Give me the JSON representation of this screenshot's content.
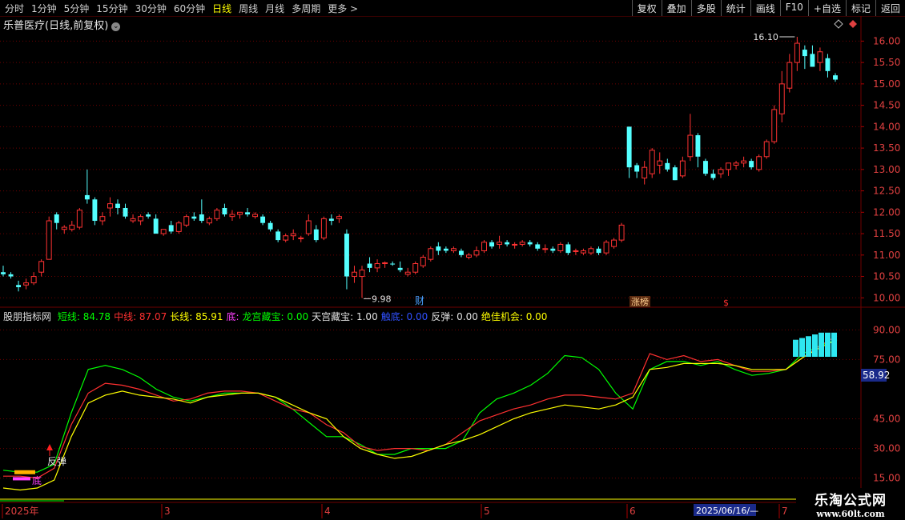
{
  "toolbar": {
    "periods": [
      "分时",
      "1分钟",
      "5分钟",
      "15分钟",
      "30分钟",
      "60分钟",
      "日线",
      "周线",
      "月线",
      "多周期",
      "更多 >"
    ],
    "active_period": "日线",
    "right_buttons": [
      "复权",
      "叠加",
      "多股",
      "统计",
      "画线",
      "F10",
      "+自选",
      "标记",
      "返回"
    ]
  },
  "stock_title": "乐普医疗(日线,前复权)",
  "indicator": {
    "name": "股朋指标网",
    "items": [
      {
        "label": "短线",
        "value": "84.78",
        "color": "#00ff00"
      },
      {
        "label": "中线",
        "value": "87.07",
        "color": "#ff3030"
      },
      {
        "label": "长线",
        "value": "85.91",
        "color": "#ffff00"
      },
      {
        "label": "底",
        "value": "",
        "color": "#ff40ff"
      },
      {
        "label": "龙宫藏宝",
        "value": "0.00",
        "color": "#00ff00"
      },
      {
        "label": "天宫藏宝",
        "value": "1.00",
        "color": "#e0e0e0"
      },
      {
        "label": "触底",
        "value": "0.00",
        "color": "#3050ff"
      },
      {
        "label": "反弹",
        "value": "0.00",
        "color": "#e0e0e0"
      },
      {
        "label": "绝佳机会",
        "value": "0.00",
        "color": "#ffff00"
      }
    ]
  },
  "annotations": {
    "high_label": "16.10",
    "low_label": "9.98",
    "rebound_label": "反弹",
    "bottom_label": "底",
    "badge_cai": "财",
    "badge_zhangbang": "涨榜",
    "badge_s": "$",
    "current_value": "58.92"
  },
  "time_axis": {
    "labels": [
      "2025年",
      "3",
      "4",
      "5",
      "6",
      "7"
    ],
    "cursor_date": "2025/06/16/—"
  },
  "watermark": {
    "line1": "乐淘公式网",
    "line2": "www.60lt.com"
  },
  "colors": {
    "up": "#ff3232",
    "down": "#54ffff",
    "grid": "#6e0000"
  },
  "chart_data": [
    {
      "type": "candlestick",
      "title": "乐普医疗(日线,前复权)",
      "ylim": [
        9.8,
        16.25
      ],
      "yticks": [
        10.0,
        10.5,
        11.0,
        11.5,
        12.0,
        12.5,
        13.0,
        13.5,
        14.0,
        14.5,
        15.0,
        15.5,
        16.0
      ],
      "high": 16.1,
      "low": 9.98,
      "ohlc": [
        [
          10.6,
          10.75,
          10.5,
          10.55
        ],
        [
          10.55,
          10.6,
          10.45,
          10.5
        ],
        [
          10.3,
          10.4,
          10.15,
          10.25
        ],
        [
          10.3,
          10.45,
          10.2,
          10.35
        ],
        [
          10.35,
          10.6,
          10.3,
          10.5
        ],
        [
          10.6,
          10.9,
          10.5,
          10.85
        ],
        [
          10.9,
          11.9,
          10.9,
          11.8
        ],
        [
          11.95,
          12.0,
          11.6,
          11.75
        ],
        [
          11.6,
          11.7,
          11.5,
          11.65
        ],
        [
          11.6,
          11.8,
          11.55,
          11.7
        ],
        [
          11.65,
          12.1,
          11.6,
          12.05
        ],
        [
          12.4,
          13.0,
          12.2,
          12.3
        ],
        [
          12.3,
          12.35,
          11.7,
          11.8
        ],
        [
          11.8,
          12.0,
          11.7,
          11.9
        ],
        [
          12.1,
          12.35,
          11.9,
          12.2
        ],
        [
          12.2,
          12.3,
          11.95,
          12.1
        ],
        [
          12.1,
          12.2,
          11.85,
          11.9
        ],
        [
          11.8,
          11.95,
          11.75,
          11.85
        ],
        [
          11.8,
          11.95,
          11.7,
          11.9
        ],
        [
          11.95,
          12.0,
          11.85,
          11.9
        ],
        [
          11.85,
          11.95,
          11.5,
          11.5
        ],
        [
          11.5,
          11.6,
          11.45,
          11.6
        ],
        [
          11.7,
          11.8,
          11.5,
          11.55
        ],
        [
          11.55,
          11.8,
          11.5,
          11.75
        ],
        [
          11.7,
          11.95,
          11.65,
          11.9
        ],
        [
          11.9,
          12.0,
          11.8,
          11.85
        ],
        [
          11.95,
          12.3,
          11.75,
          11.8
        ],
        [
          11.75,
          11.9,
          11.7,
          11.85
        ],
        [
          11.85,
          12.1,
          11.8,
          12.05
        ],
        [
          12.1,
          12.2,
          11.9,
          11.95
        ],
        [
          11.9,
          12.05,
          11.8,
          11.95
        ],
        [
          11.95,
          12.0,
          11.85,
          12.0
        ],
        [
          12.0,
          12.1,
          11.9,
          11.95
        ],
        [
          11.9,
          12.0,
          11.85,
          11.95
        ],
        [
          11.9,
          11.95,
          11.7,
          11.75
        ],
        [
          11.75,
          11.8,
          11.55,
          11.6
        ],
        [
          11.55,
          11.6,
          11.3,
          11.35
        ],
        [
          11.35,
          11.5,
          11.3,
          11.45
        ],
        [
          11.45,
          11.6,
          11.35,
          11.5
        ],
        [
          11.4,
          11.45,
          11.3,
          11.4
        ],
        [
          11.5,
          11.95,
          11.45,
          11.8
        ],
        [
          11.6,
          11.7,
          11.3,
          11.35
        ],
        [
          11.4,
          11.9,
          11.35,
          11.85
        ],
        [
          11.85,
          11.95,
          11.7,
          11.8
        ],
        [
          11.85,
          11.95,
          11.75,
          11.9
        ],
        [
          11.5,
          11.6,
          10.2,
          10.5
        ],
        [
          10.5,
          10.75,
          10.35,
          10.6
        ],
        [
          10.5,
          10.75,
          10.0,
          10.65
        ],
        [
          10.8,
          10.95,
          10.6,
          10.7
        ],
        [
          10.7,
          10.9,
          10.6,
          10.8
        ],
        [
          10.8,
          10.85,
          10.7,
          10.82
        ],
        [
          10.8,
          10.85,
          10.75,
          10.78
        ],
        [
          10.7,
          10.85,
          10.6,
          10.65
        ],
        [
          10.55,
          10.7,
          10.5,
          10.6
        ],
        [
          10.6,
          10.85,
          10.55,
          10.8
        ],
        [
          10.75,
          11.0,
          10.7,
          10.95
        ],
        [
          10.9,
          11.2,
          10.85,
          11.15
        ],
        [
          11.2,
          11.3,
          11.0,
          11.1
        ],
        [
          11.15,
          11.2,
          11.05,
          11.1
        ],
        [
          11.1,
          11.2,
          11.05,
          11.15
        ],
        [
          11.1,
          11.15,
          10.95,
          11.0
        ],
        [
          10.95,
          11.05,
          10.9,
          11.0
        ],
        [
          11.0,
          11.2,
          10.95,
          11.1
        ],
        [
          11.1,
          11.35,
          11.05,
          11.3
        ],
        [
          11.3,
          11.35,
          11.15,
          11.2
        ],
        [
          11.25,
          11.45,
          11.15,
          11.3
        ],
        [
          11.3,
          11.35,
          11.2,
          11.25
        ],
        [
          11.25,
          11.3,
          11.15,
          11.25
        ],
        [
          11.25,
          11.35,
          11.2,
          11.3
        ],
        [
          11.3,
          11.35,
          11.2,
          11.25
        ],
        [
          11.25,
          11.3,
          11.1,
          11.15
        ],
        [
          11.15,
          11.25,
          11.05,
          11.15
        ],
        [
          11.15,
          11.2,
          11.05,
          11.1
        ],
        [
          11.1,
          11.3,
          11.05,
          11.25
        ],
        [
          11.25,
          11.3,
          11.0,
          11.05
        ],
        [
          11.1,
          11.15,
          11.0,
          11.1
        ],
        [
          11.05,
          11.15,
          11.0,
          11.1
        ],
        [
          11.05,
          11.2,
          11.0,
          11.15
        ],
        [
          11.15,
          11.2,
          11.0,
          11.05
        ],
        [
          11.05,
          11.35,
          11.0,
          11.3
        ],
        [
          11.2,
          11.4,
          11.15,
          11.35
        ],
        [
          11.35,
          11.75,
          11.3,
          11.7
        ],
        [
          14.0,
          14.0,
          12.8,
          13.05
        ],
        [
          13.1,
          13.15,
          12.8,
          12.95
        ],
        [
          12.8,
          13.2,
          12.65,
          13.05
        ],
        [
          12.9,
          13.5,
          12.8,
          13.45
        ],
        [
          13.1,
          13.4,
          12.9,
          13.2
        ],
        [
          13.15,
          13.25,
          12.95,
          13.0
        ],
        [
          13.05,
          13.1,
          12.75,
          12.75
        ],
        [
          12.85,
          13.3,
          12.8,
          13.2
        ],
        [
          13.3,
          14.3,
          13.2,
          13.8
        ],
        [
          13.8,
          13.85,
          13.05,
          13.3
        ],
        [
          13.2,
          13.25,
          12.85,
          12.9
        ],
        [
          12.9,
          13.0,
          12.75,
          12.8
        ],
        [
          12.9,
          13.05,
          12.8,
          13.0
        ],
        [
          13.0,
          13.15,
          12.85,
          13.15
        ],
        [
          13.1,
          13.2,
          13.0,
          13.15
        ],
        [
          13.15,
          13.3,
          13.05,
          13.2
        ],
        [
          13.2,
          13.25,
          13.0,
          13.05
        ],
        [
          13.0,
          13.35,
          12.95,
          13.3
        ],
        [
          13.3,
          13.7,
          13.25,
          13.65
        ],
        [
          13.65,
          14.5,
          13.6,
          14.4
        ],
        [
          14.3,
          15.3,
          14.1,
          15.0
        ],
        [
          14.9,
          15.7,
          14.8,
          15.5
        ],
        [
          15.5,
          16.1,
          15.3,
          15.95
        ],
        [
          15.8,
          15.9,
          15.35,
          15.65
        ],
        [
          15.7,
          15.9,
          15.4,
          15.4
        ],
        [
          15.5,
          15.85,
          15.3,
          15.75
        ],
        [
          15.6,
          15.7,
          15.15,
          15.3
        ],
        [
          15.2,
          15.25,
          15.05,
          15.1
        ]
      ]
    },
    {
      "type": "line",
      "title": "股朋指标网",
      "ylim": [
        10,
        95
      ],
      "yticks": [
        15.0,
        30.0,
        45.0,
        75.0,
        90.0
      ],
      "series": [
        {
          "name": "短线",
          "color": "#00ff00",
          "values": [
            19,
            18,
            18,
            22,
            48,
            70,
            72,
            70,
            66,
            60,
            56,
            54,
            56,
            58,
            58,
            58,
            56,
            50,
            43,
            36,
            36,
            32,
            27,
            27,
            30,
            30,
            30,
            34,
            48,
            55,
            58,
            62,
            68,
            77,
            76,
            70,
            58,
            50,
            70,
            74,
            74,
            72,
            74,
            70,
            67,
            68,
            70,
            78,
            82,
            85
          ]
        },
        {
          "name": "中线",
          "color": "#ff3030",
          "values": [
            16,
            16,
            15,
            20,
            42,
            58,
            63,
            62,
            60,
            57,
            54,
            55,
            58,
            59,
            59,
            58,
            54,
            50,
            48,
            42,
            38,
            31,
            29,
            30,
            30,
            29,
            32,
            38,
            44,
            47,
            50,
            52,
            55,
            57,
            57,
            56,
            55,
            58,
            78,
            75,
            77,
            74,
            75,
            72,
            69,
            69,
            70,
            76,
            82,
            87
          ]
        },
        {
          "name": "长线",
          "color": "#ffff00",
          "values": [
            10,
            9,
            10,
            14,
            36,
            53,
            57,
            59,
            57,
            56,
            55,
            53,
            56,
            57,
            58,
            58,
            56,
            52,
            48,
            45,
            36,
            30,
            27,
            25,
            26,
            29,
            32,
            34,
            37,
            41,
            45,
            48,
            50,
            52,
            51,
            50,
            52,
            56,
            70,
            71,
            73,
            73,
            73,
            72,
            70,
            70,
            70,
            76,
            81,
            85
          ]
        }
      ]
    }
  ]
}
